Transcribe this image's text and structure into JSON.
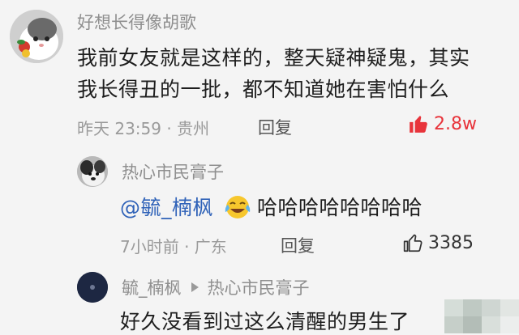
{
  "comments": [
    {
      "author": "好想长得像胡歌",
      "text_line1": "我前女友就是这样的，整天疑神疑鬼，其实",
      "text_line2": "我长得丑的一批，都不知道她在害怕什么",
      "meta": "昨天 23:59 · 贵州",
      "reply_label": "回复",
      "likes": "2.8w",
      "likes_color": "#e8343b",
      "like_icon": "thumb-up-filled-icon"
    },
    {
      "author": "热心市民膏子",
      "mention": "@毓_楠枫",
      "emoji_icon": "laughing-crying-emoji-icon",
      "text": "哈哈哈哈哈哈哈哈",
      "meta": "7小时前 · 广东",
      "reply_label": "回复",
      "likes": "3385",
      "like_icon": "thumb-up-outline-icon"
    },
    {
      "author": "毓_楠枫",
      "reply_arrow_icon": "play-arrow-icon",
      "reply_to": "热心市民膏子",
      "text": "好久没看到过这么清醒的男生了"
    }
  ]
}
